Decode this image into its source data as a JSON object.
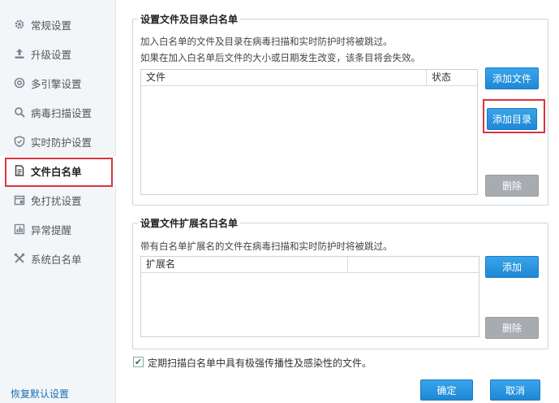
{
  "sidebar": {
    "items": [
      {
        "label": "常规设置",
        "icon": "gear-icon"
      },
      {
        "label": "升级设置",
        "icon": "upload-icon"
      },
      {
        "label": "多引擎设置",
        "icon": "engine-icon"
      },
      {
        "label": "病毒扫描设置",
        "icon": "search-icon"
      },
      {
        "label": "实时防护设置",
        "icon": "shield-icon"
      },
      {
        "label": "文件白名单",
        "icon": "document-icon"
      },
      {
        "label": "免打扰设置",
        "icon": "calendar-icon"
      },
      {
        "label": "异常提醒",
        "icon": "bar-chart-icon"
      },
      {
        "label": "系统白名单",
        "icon": "tools-icon"
      }
    ],
    "restore_label": "恢复默认设置"
  },
  "file_whitelist": {
    "title": "设置文件及目录白名单",
    "desc1": "加入白名单的文件及目录在病毒扫描和实时防护时将被跳过。",
    "desc2": "如果在加入白名单后文件的大小或日期发生改变，该条目将会失效。",
    "col_file": "文件",
    "col_status": "状态",
    "add_file": "添加文件",
    "add_dir": "添加目录",
    "delete": "删除"
  },
  "ext_whitelist": {
    "title": "设置文件扩展名白名单",
    "desc": "带有白名单扩展名的文件在病毒扫描和实时防护时将被跳过。",
    "col_ext": "扩展名",
    "add": "添加",
    "delete": "删除"
  },
  "periodic_scan": {
    "checked": true,
    "label": "定期扫描白名单中具有极强传播性及感染性的文件。"
  },
  "footer": {
    "ok": "确定",
    "cancel": "取消"
  }
}
